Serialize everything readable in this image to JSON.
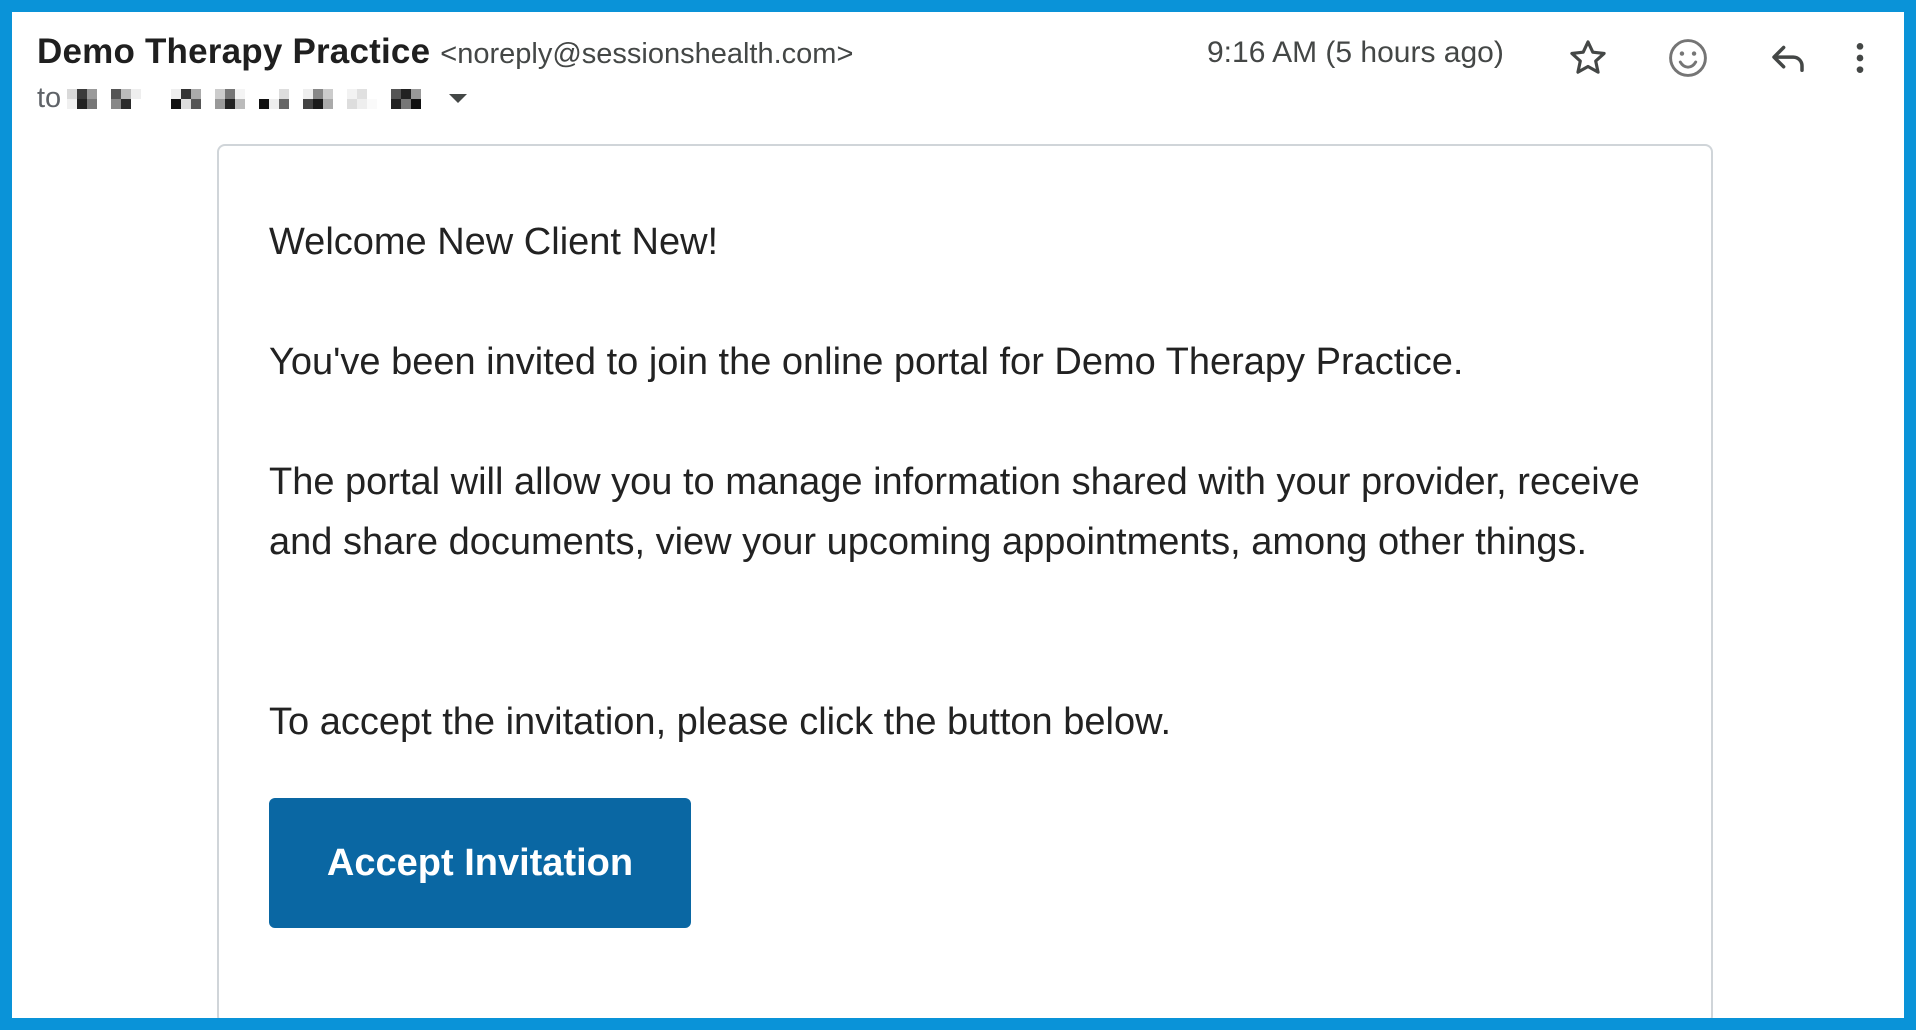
{
  "header": {
    "sender_name": "Demo Therapy Practice",
    "sender_email": "<noreply@sessionshealth.com>",
    "to_label": "to",
    "recipient_redacted": true,
    "timestamp": "9:16 AM (5 hours ago)"
  },
  "actions": [
    {
      "name": "star",
      "icon": "star-icon"
    },
    {
      "name": "emoji-react",
      "icon": "smiley-icon"
    },
    {
      "name": "reply",
      "icon": "reply-icon"
    },
    {
      "name": "more",
      "icon": "more-vert-icon"
    }
  ],
  "message": {
    "greeting": "Welcome New Client New!",
    "paragraph_1": "You've been invited to join the online portal for Demo Therapy Practice.",
    "paragraph_2": "The portal will allow you to manage information shared with your provider, receive and share documents, view your upcoming appointments, among other things.",
    "paragraph_3": "To accept the invitation, please click the button below.",
    "button_label": "Accept Invitation"
  },
  "colors": {
    "frame_border": "#0a93d8",
    "button_bg": "#0a67a3",
    "button_text": "#ffffff",
    "card_border": "#d0d5d9"
  }
}
